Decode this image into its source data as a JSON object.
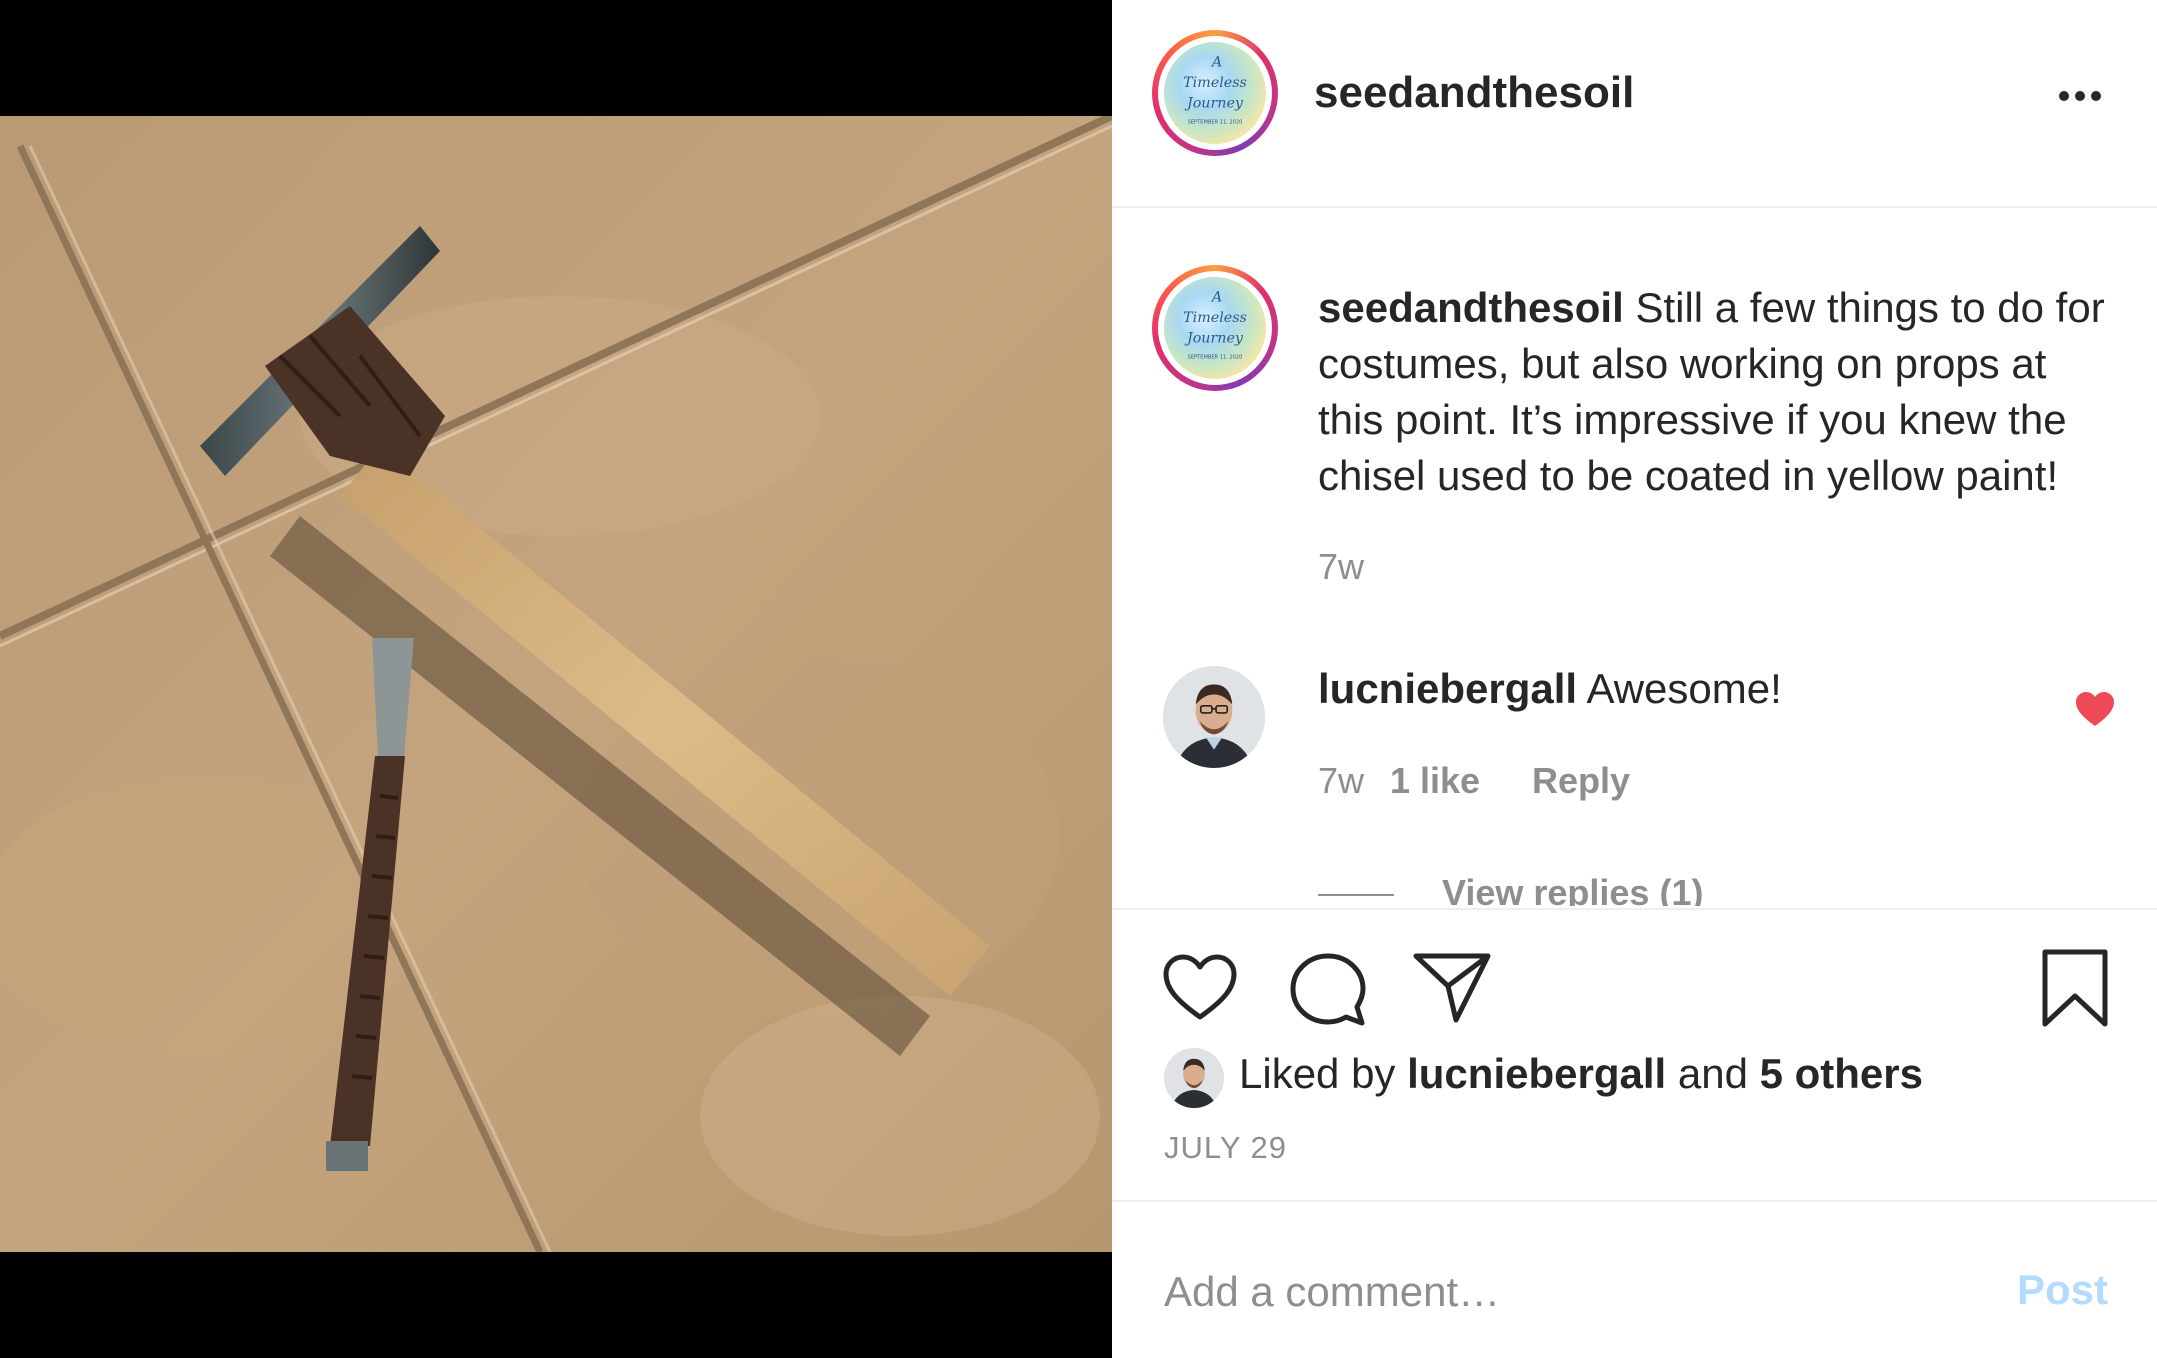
{
  "post": {
    "author": "seedandthesoil",
    "avatar_text": [
      "A",
      "Timeless",
      "Journey",
      "SEPTEMBER 11, 2020"
    ],
    "more_icon": "more-horizontal-icon"
  },
  "caption": {
    "username": "seedandthesoil",
    "text": "Still a few things to do for costumes, but also working on props at this point. It’s impressive if you knew the chisel used to be coated in yellow paint!",
    "time": "7w"
  },
  "comments": [
    {
      "username": "lucniebergall",
      "text": "Awesome!",
      "time": "7w",
      "likes": "1 like",
      "reply_label": "Reply",
      "liked": true,
      "view_replies": "View replies (1)"
    }
  ],
  "actions": {
    "like_icon": "heart-icon",
    "comment_icon": "comment-icon",
    "share_icon": "send-icon",
    "save_icon": "bookmark-icon"
  },
  "likes": {
    "prefix": "Liked by",
    "user": "lucniebergall",
    "connector": "and",
    "others": "5 others"
  },
  "date": "JULY 29",
  "add_comment": {
    "placeholder": "Add a comment…",
    "post_label": "Post"
  },
  "colors": {
    "heart_red": "#ed4956",
    "post_disabled": "#b3dbff",
    "meta_gray": "#8e8e8e"
  }
}
